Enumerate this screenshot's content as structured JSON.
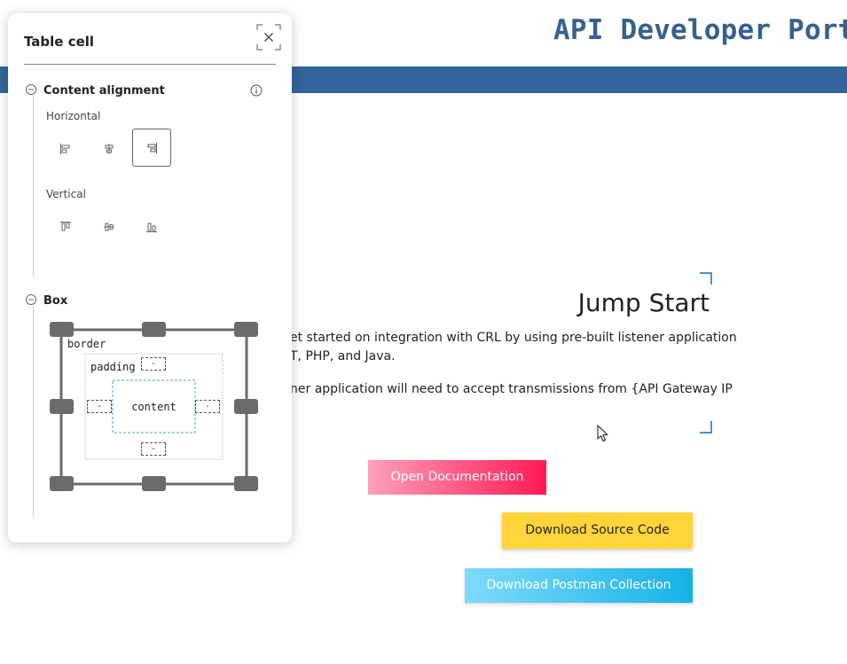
{
  "header": {
    "title": "API Developer Portal"
  },
  "jump_start": {
    "title": "Jump Start",
    "line1": "et started on integration with CRL by using pre-built listener application",
    "line2": "T, PHP, and Java.",
    "line3": "ner application will need to accept transmissions from {API Gateway IP"
  },
  "buttons": {
    "open_docs": "Open Documentation",
    "download_source": "Download Source Code",
    "download_postman": "Download Postman Collection"
  },
  "panel": {
    "title": "Table cell",
    "content_alignment": {
      "title": "Content alignment",
      "horizontal_label": "Horizontal",
      "vertical_label": "Vertical",
      "horizontal_selected": "right"
    },
    "box": {
      "title": "Box",
      "border_label": "border",
      "padding_label": "padding",
      "content_label": "content",
      "padding_top": "-",
      "padding_bottom": "-",
      "padding_left": "-",
      "padding_right": "-"
    }
  },
  "colors": {
    "header_bar": "#33659a",
    "title_text": "#36618f",
    "corner_accent": "#4a8fd0",
    "doc_button": "#ff1a55",
    "source_button": "#ffd53a",
    "postman_button": "#17b1e6"
  },
  "icons": {
    "expand": "expand-icon",
    "close": "close-icon",
    "info": "info-icon",
    "collapse": "minus-circle-icon",
    "cursor": "mouse-pointer-icon"
  }
}
